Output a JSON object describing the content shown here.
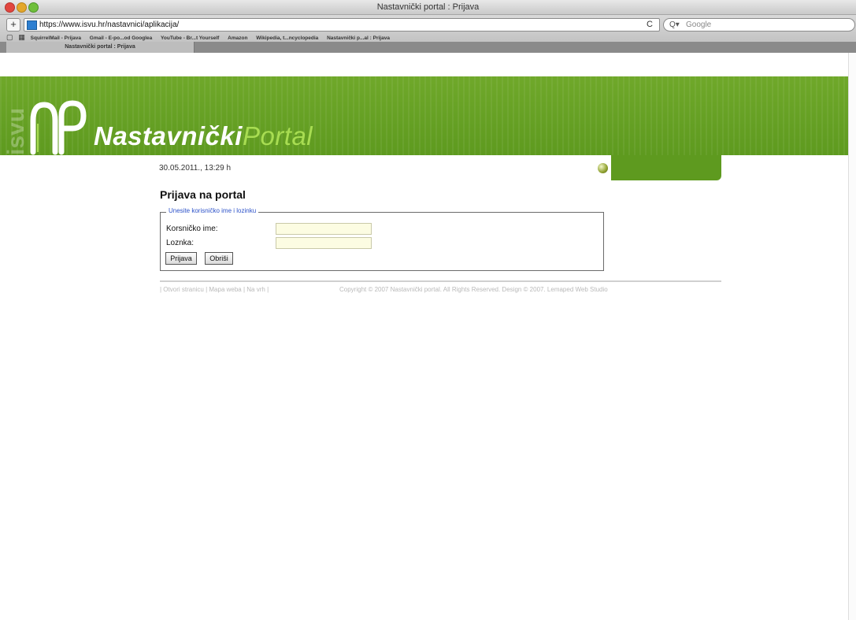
{
  "window": {
    "title": "Nastavnički portal : Prijava"
  },
  "toolbar": {
    "url": "https://www.isvu.hr/nastavnici/aplikacija/",
    "search_placeholder": "Google",
    "reload_symbol": "C"
  },
  "bookmarks": [
    "SquirrelMail - Prijava",
    "Gmail - E-po...od Googlea",
    "YouTube - Br...t Yourself",
    "Amazon",
    "Wikipedia, t...ncyclopedia",
    "Nastavnički p...al : Prijava"
  ],
  "tab": {
    "label": "Nastavnički portal : Prijava"
  },
  "header": {
    "logo_mark": "NP",
    "brand_part1": "Nastavnički",
    "brand_part2": "Portal",
    "side_mark": "isvu",
    "date_text": "30.05.2011., 13:29 h",
    "colors": {
      "band": "#5e9a1f",
      "brand_accent": "#a8dd52"
    }
  },
  "main": {
    "title": "Prijava na portal",
    "legend": "Unesite korisničko ime i lozinku",
    "username_label": "Korsničko ime:",
    "password_label": "Loznka:",
    "login_button": "Prijava",
    "clear_button": "Obriši",
    "username_value": "",
    "password_value": ""
  },
  "footer": {
    "links": "| Otvori stranicu | Mapa weba | Na vrh |",
    "copyright": "Copyright © 2007 Nastavnički portal. All Rights Reserved. Design © 2007. Lemaped Web Studio"
  }
}
